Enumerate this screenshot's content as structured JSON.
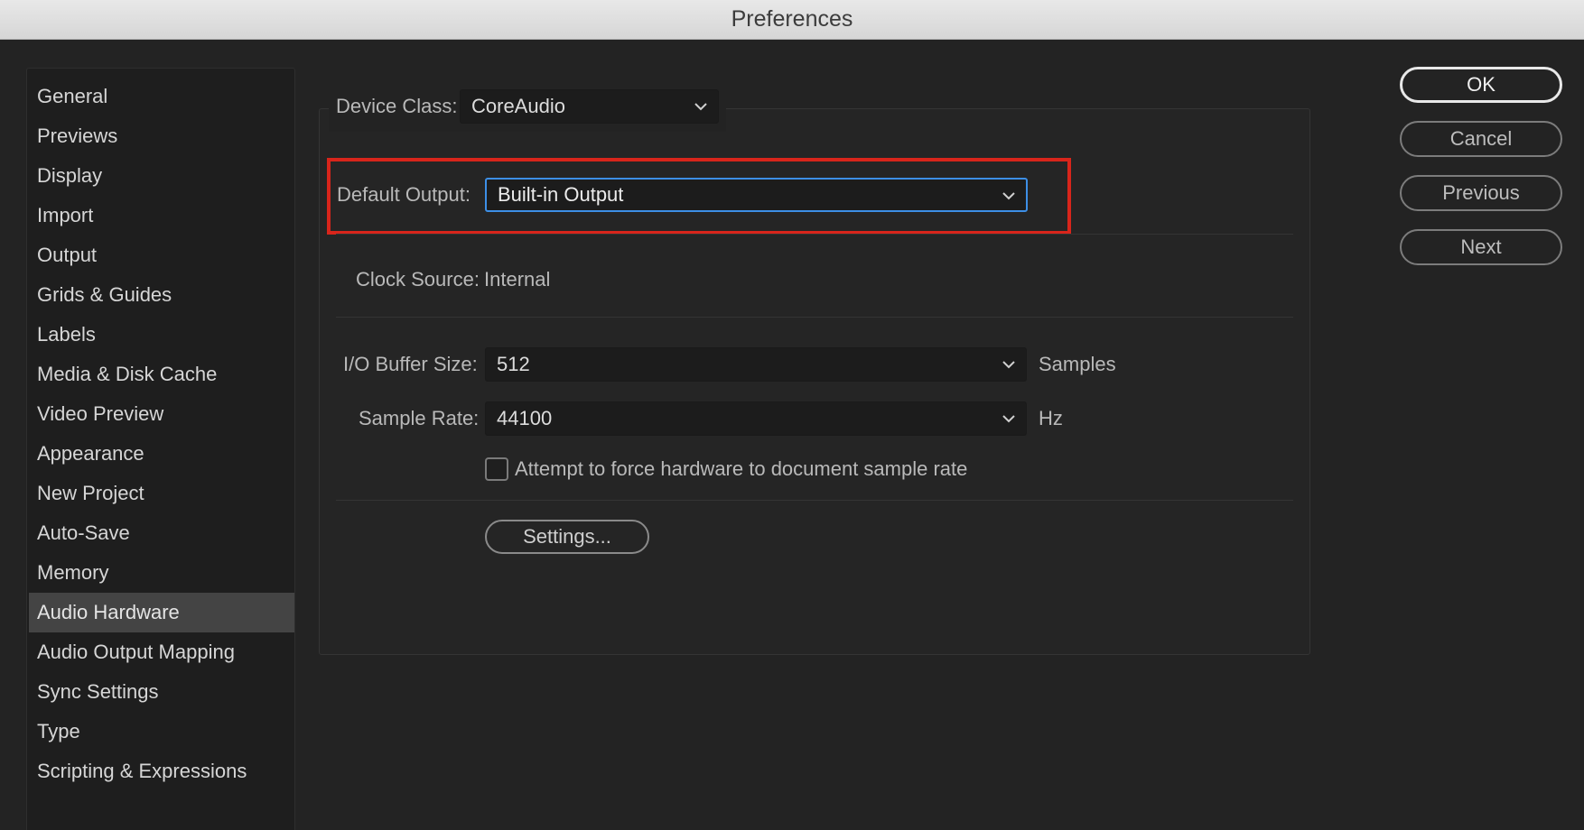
{
  "window": {
    "title": "Preferences"
  },
  "sidebar": {
    "items": [
      {
        "label": "General"
      },
      {
        "label": "Previews"
      },
      {
        "label": "Display"
      },
      {
        "label": "Import"
      },
      {
        "label": "Output"
      },
      {
        "label": "Grids & Guides"
      },
      {
        "label": "Labels"
      },
      {
        "label": "Media & Disk Cache"
      },
      {
        "label": "Video Preview"
      },
      {
        "label": "Appearance"
      },
      {
        "label": "New Project"
      },
      {
        "label": "Auto-Save"
      },
      {
        "label": "Memory"
      },
      {
        "label": "Audio Hardware",
        "selected": true
      },
      {
        "label": "Audio Output Mapping"
      },
      {
        "label": "Sync Settings"
      },
      {
        "label": "Type"
      },
      {
        "label": "Scripting & Expressions"
      }
    ]
  },
  "audio": {
    "device_class": {
      "label": "Device Class:",
      "value": "CoreAudio"
    },
    "default_output": {
      "label": "Default Output:",
      "value": "Built-in Output"
    },
    "clock_source": {
      "label": "Clock Source:",
      "value": "Internal"
    },
    "buffer_size": {
      "label": "I/O Buffer Size:",
      "value": "512",
      "unit": "Samples"
    },
    "sample_rate": {
      "label": "Sample Rate:",
      "value": "44100",
      "unit": "Hz"
    },
    "force_rate": {
      "label": "Attempt to force hardware to document sample rate",
      "checked": false
    },
    "settings_button": "Settings..."
  },
  "buttons": {
    "ok": "OK",
    "cancel": "Cancel",
    "previous": "Previous",
    "next": "Next"
  },
  "colors": {
    "highlight": "#d8251b",
    "focus": "#3d8fe6",
    "background": "#232323"
  },
  "icons": {
    "dropdown": "chevron-down-icon"
  }
}
